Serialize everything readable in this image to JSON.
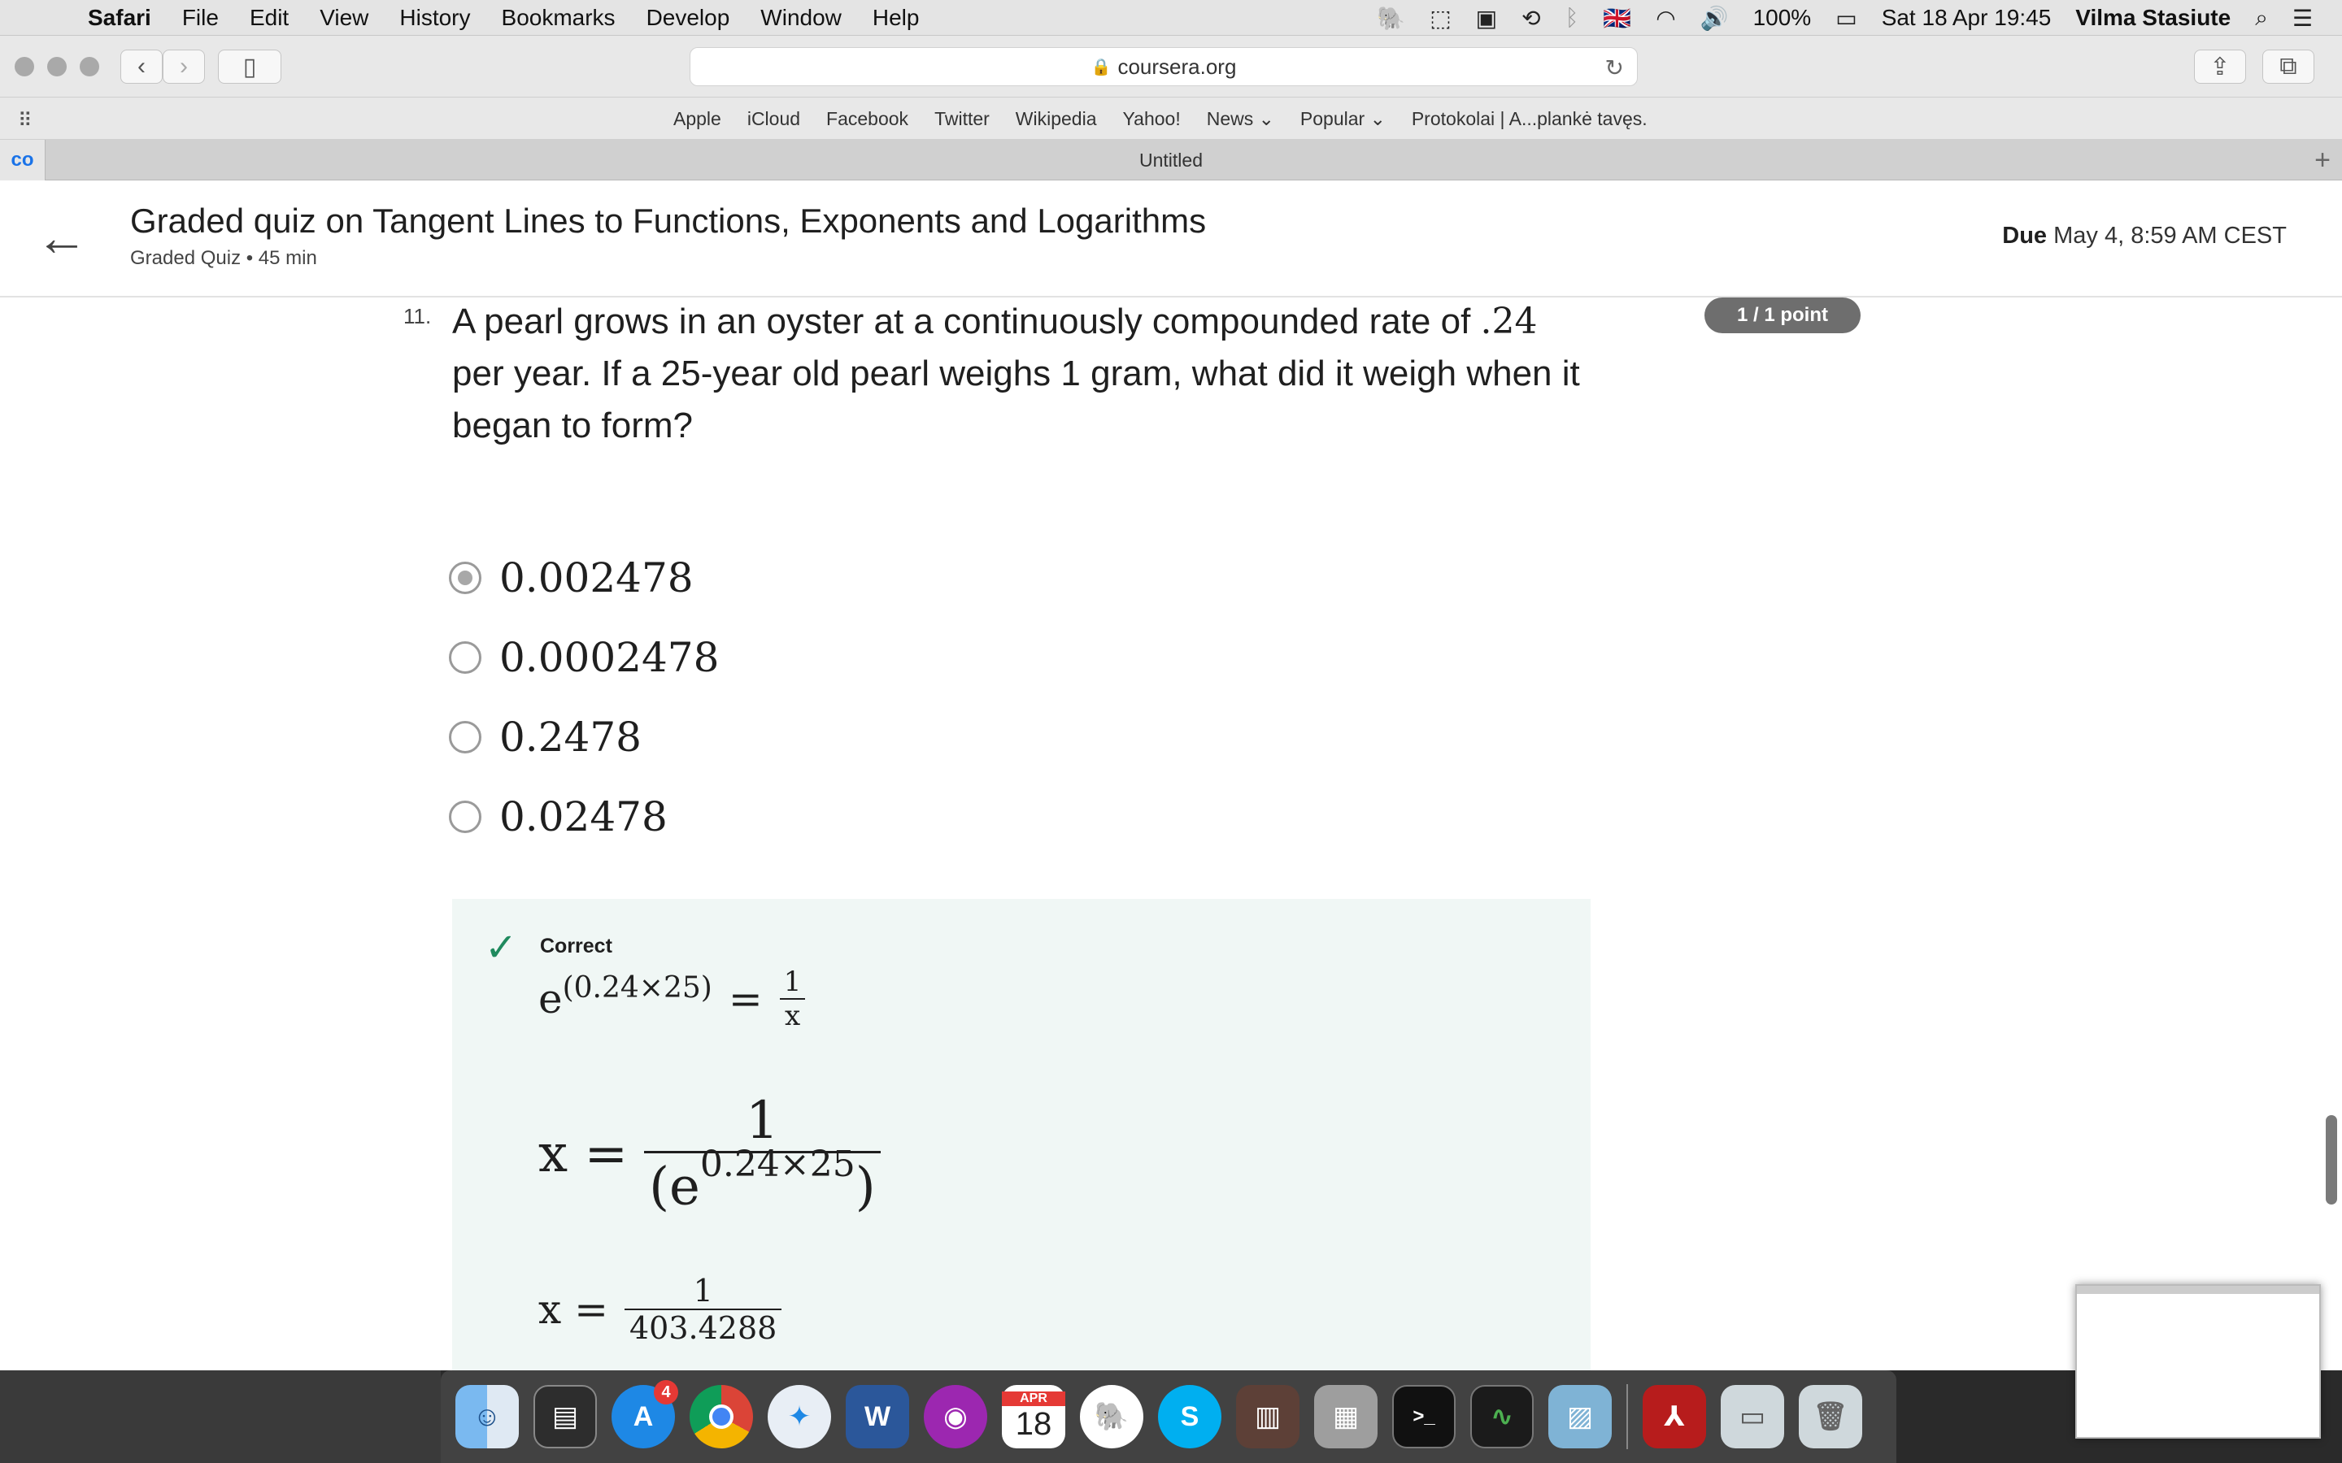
{
  "menubar": {
    "app": "Safari",
    "items": [
      "File",
      "Edit",
      "View",
      "History",
      "Bookmarks",
      "Develop",
      "Window",
      "Help"
    ],
    "battery": "100%",
    "datetime": "Sat 18 Apr  19:45",
    "user": "Vilma Stasiute"
  },
  "toolbar": {
    "url": "coursera.org"
  },
  "bookmarks": [
    "Apple",
    "iCloud",
    "Facebook",
    "Twitter",
    "Wikipedia",
    "Yahoo!",
    "News ⌄",
    "Popular ⌄",
    "Protokolai | A...plankė tavęs."
  ],
  "tab": {
    "title": "Untitled"
  },
  "quiz": {
    "title": "Graded quiz on Tangent Lines to Functions, Exponents and Logarithms",
    "subtitle": "Graded Quiz • 45 min",
    "due_label": "Due",
    "due_value": "May 4, 8:59 AM CEST"
  },
  "question": {
    "number": "11.",
    "text_before": "A pearl grows in an oyster at a continuously compounded rate of",
    "rate": ".24",
    "text_after": "per year. If a 25-year old pearl weighs 1 gram, what did it weigh when it began to form?",
    "points": "1 / 1 point",
    "options": [
      {
        "label": "0.002478",
        "selected": true
      },
      {
        "label": "0.0002478",
        "selected": false
      },
      {
        "label": "0.2478",
        "selected": false
      },
      {
        "label": "0.02478",
        "selected": false
      }
    ]
  },
  "feedback": {
    "status": "Correct",
    "eq1_lhs_base": "e",
    "eq1_lhs_exp": "(0.24×25)",
    "eq1_eq": "=",
    "eq1_num": "1",
    "eq1_den": "x",
    "eq2_lhs": "x =",
    "eq2_num": "1",
    "eq2_den_open": "(e",
    "eq2_den_exp": "0.24×25",
    "eq2_den_close": ")",
    "eq3_lhs": "x =",
    "eq3_num": "1",
    "eq3_den": "403.4288"
  },
  "dock": {
    "appstore_badge": "4",
    "calendar_month": "APR",
    "calendar_day": "18"
  }
}
